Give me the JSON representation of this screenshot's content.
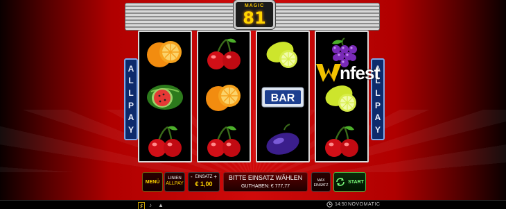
{
  "marquee": {
    "top_text": "MAGIC",
    "number": "81"
  },
  "side_banner": {
    "letters": [
      "A",
      "L",
      "L",
      "P",
      "A",
      "Y"
    ]
  },
  "logo": {
    "text": "nfest"
  },
  "reels": [
    [
      "orange",
      "watermelon",
      "cherry"
    ],
    [
      "cherry",
      "orange",
      "cherry"
    ],
    [
      "lemon",
      "bar",
      "plum"
    ],
    [
      "grapes",
      "lemon",
      "cherry"
    ]
  ],
  "bar_symbol_text": "BAR",
  "controls": {
    "menu_label": "MENÜ",
    "lines_label": "LINIEN",
    "lines_value": "ALLPAY",
    "stake_label": "EINSATZ",
    "stake_value": "€ 1,00",
    "stake_minus": "-",
    "stake_plus": "+",
    "message": "BITTE EINSATZ WÄHLEN",
    "balance": "GUTHABEN: € 777,77",
    "max_line1": "MAX",
    "max_line2": "EINSATZ",
    "start_label": "START"
  },
  "footer": {
    "time": "14:50",
    "brand": "NOVOMATIC"
  },
  "colors": {
    "gold": "#ffd400",
    "start_green": "#3fb83f",
    "bg_red": "#d00a0a",
    "allpay_blue": "#0d2a6b"
  }
}
